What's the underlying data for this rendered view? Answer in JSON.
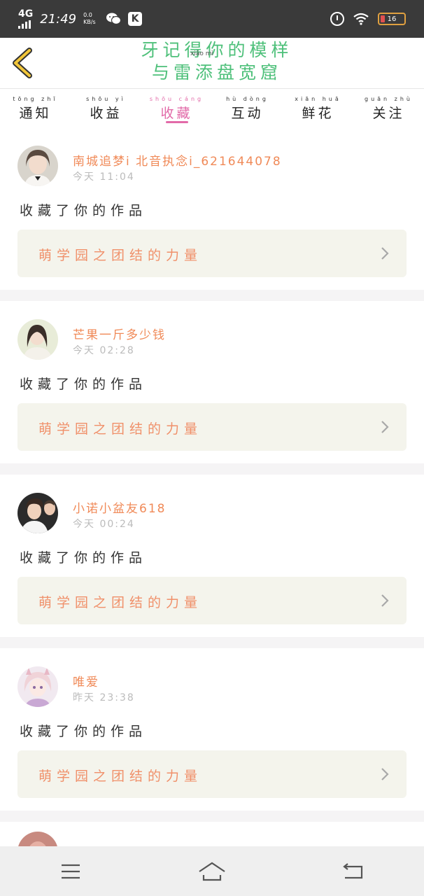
{
  "status_bar": {
    "network": "4G",
    "time": "21:49",
    "speed": "0.0 KB/s",
    "app_badge": "K",
    "battery": "16",
    "icons": [
      "signal-icon",
      "wechat-icon",
      "k-app-icon",
      "alarm-icon",
      "wifi-icon",
      "battery-icon"
    ]
  },
  "header": {
    "title_line1": "牙记得你的模样",
    "title_line2": "与雷添盘宽窟",
    "title_pinyin": "xiǎo mì",
    "back_icon": "back-chevron-icon"
  },
  "tabs": [
    {
      "pinyin": "tōng zhī",
      "label": "通知"
    },
    {
      "pinyin": "shōu yì",
      "label": "收益"
    },
    {
      "pinyin": "shōu cáng",
      "label": "收藏"
    },
    {
      "pinyin": "hù dòng",
      "label": "互动"
    },
    {
      "pinyin": "xiān huā",
      "label": "鲜花"
    },
    {
      "pinyin": "guān zhù",
      "label": "关注"
    }
  ],
  "active_tab": 2,
  "colors": {
    "accent": "#e26aa8",
    "username": "#f08a58",
    "title": "#4ec07a",
    "card_bg": "#f4f4ec"
  },
  "items": [
    {
      "username": "南城追梦i 北音执念i_621644078",
      "time": "今天 11:04",
      "action": "收藏了你的作品",
      "work": "萌学园之团结的力量"
    },
    {
      "username": "芒果一斤多少钱",
      "time": "今天 02:28",
      "action": "收藏了你的作品",
      "work": "萌学园之团结的力量"
    },
    {
      "username": "小诺小盆友618",
      "time": "今天 00:24",
      "action": "收藏了你的作品",
      "work": "萌学园之团结的力量"
    },
    {
      "username": "唯爱",
      "time": "昨天 23:38",
      "action": "收藏了你的作品",
      "work": "萌学园之团结的力量"
    }
  ],
  "nav": {
    "icons": [
      "menu-icon",
      "home-icon",
      "back-icon"
    ]
  }
}
